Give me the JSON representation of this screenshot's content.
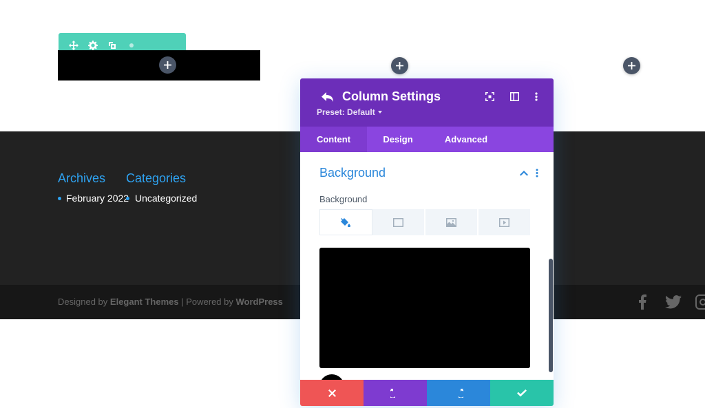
{
  "builder": {
    "toolbar_icons": [
      "move-icon",
      "gear-icon",
      "duplicate-icon",
      "more-icon"
    ],
    "add_icon": "plus-icon"
  },
  "footer": {
    "widgets": [
      {
        "title": "Archives",
        "items": [
          "February 2022"
        ]
      },
      {
        "title": "Categories",
        "items": [
          "Uncategorized"
        ]
      }
    ],
    "credits": {
      "designed_by": "Designed by",
      "theme": "Elegant Themes",
      "separator": "| Powered by",
      "platform": "WordPress"
    },
    "social_icons": [
      "facebook-icon",
      "twitter-icon",
      "instagram-icon"
    ]
  },
  "modal": {
    "title": "Column Settings",
    "preset": "Preset: Default",
    "tabs": [
      {
        "label": "Content",
        "active": true
      },
      {
        "label": "Design",
        "active": false
      },
      {
        "label": "Advanced",
        "active": false
      }
    ],
    "section": {
      "title": "Background",
      "field_label": "Background",
      "background_types": [
        "paint-bucket-icon",
        "gradient-icon",
        "image-icon",
        "video-icon"
      ],
      "color": "#000000"
    },
    "actions": [
      {
        "name": "cancel",
        "color": "#ef5555"
      },
      {
        "name": "undo",
        "color": "#7e3bd0"
      },
      {
        "name": "redo",
        "color": "#2b87da"
      },
      {
        "name": "save",
        "color": "#29c4a9"
      }
    ]
  },
  "colors": {
    "accent": "#2ea3f2",
    "modal_header": "#6c2eb9",
    "tabs": "#8a45e0",
    "toolbar": "#4fd1b8"
  }
}
